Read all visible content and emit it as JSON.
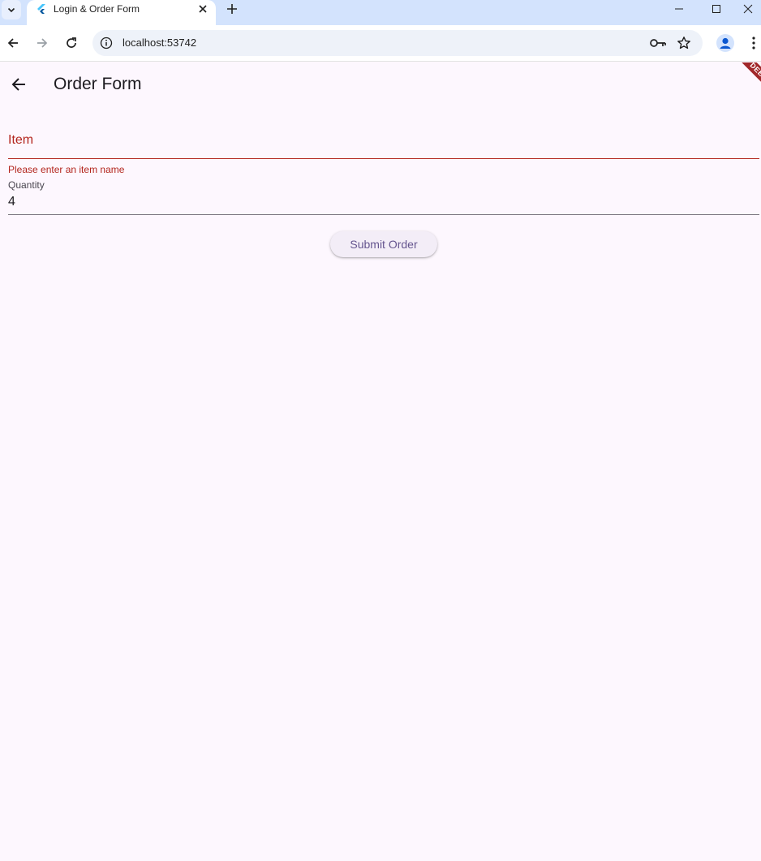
{
  "browser": {
    "tab": {
      "title": "Login & Order Form"
    },
    "address": {
      "url": "localhost:53742"
    }
  },
  "app": {
    "title": "Order Form",
    "debug_banner": "DEBUG",
    "form": {
      "item": {
        "label": "Item",
        "value": "",
        "error": "Please enter an item name"
      },
      "quantity": {
        "label": "Quantity",
        "value": "4"
      },
      "submit_label": "Submit Order"
    }
  },
  "colors": {
    "app_background": "#fdf7fe",
    "error": "#b3261e",
    "button_text": "#65558f",
    "tabbar": "#d3e3fd",
    "debug_banner": "#a1282a"
  }
}
